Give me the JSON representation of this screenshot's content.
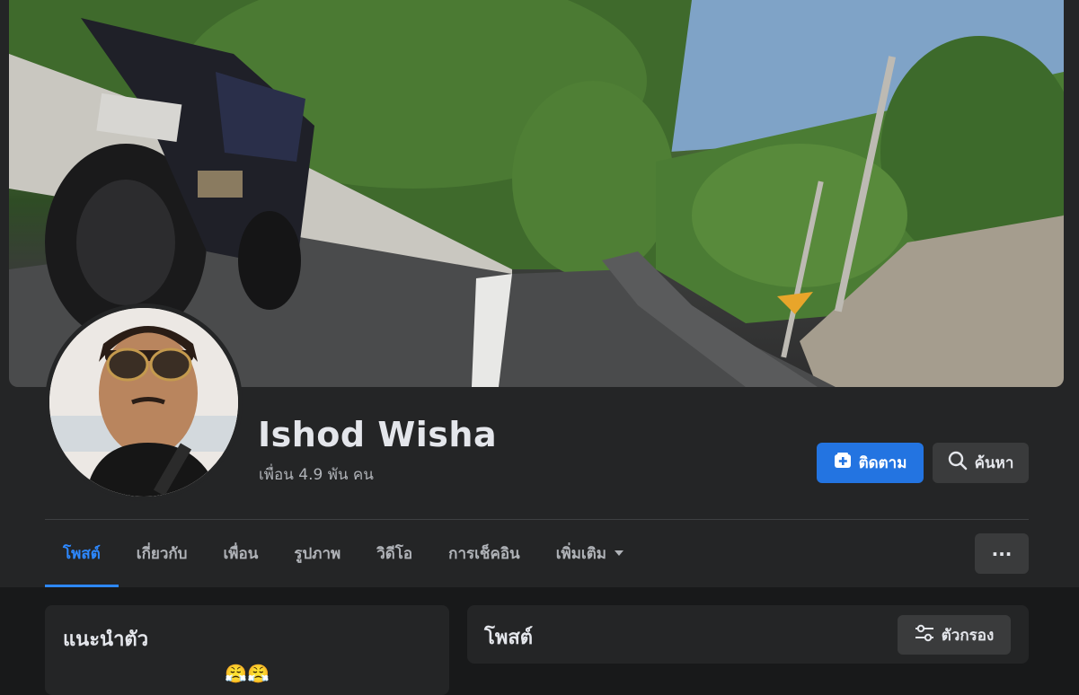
{
  "profile": {
    "name": "Ishod Wisha",
    "friends": "เพื่อน 4.9 พัน คน"
  },
  "actions": {
    "follow_label": "ติดตาม",
    "search_label": "ค้นหา",
    "more_label": "···"
  },
  "tabs": [
    {
      "label": "โพสต์",
      "active": true
    },
    {
      "label": "เกี่ยวกับ"
    },
    {
      "label": "เพื่อน"
    },
    {
      "label": "รูปภาพ"
    },
    {
      "label": "วิดีโอ"
    },
    {
      "label": "การเช็คอิน"
    },
    {
      "label": "เพิ่มเติม"
    }
  ],
  "intro": {
    "title": "แนะนำตัว",
    "emoji": [
      "😤",
      "😤"
    ]
  },
  "posts": {
    "title": "โพสต์",
    "filter_label": "ตัวกรอง"
  },
  "colors": {
    "accent": "#2d88ff",
    "primary_button": "#2374e1",
    "surface": "#242526",
    "background": "#18191a"
  }
}
